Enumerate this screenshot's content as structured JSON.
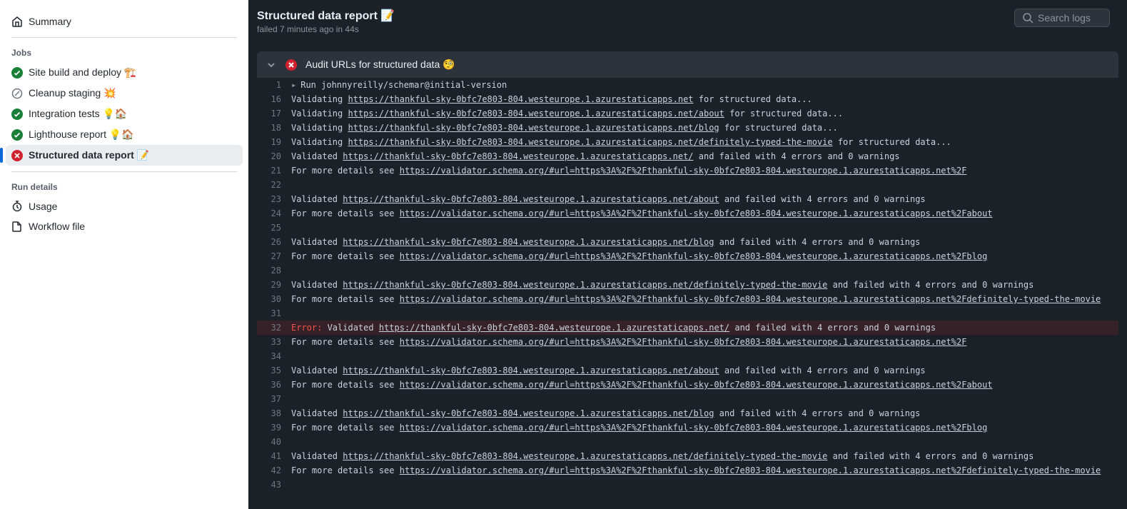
{
  "sidebar": {
    "summary_label": "Summary",
    "jobs_heading": "Jobs",
    "jobs": [
      {
        "status": "success",
        "label": "Site build and deploy 🏗️"
      },
      {
        "status": "skipped",
        "label": "Cleanup staging 💥"
      },
      {
        "status": "success",
        "label": "Integration tests 💡🏠"
      },
      {
        "status": "success",
        "label": "Lighthouse report 💡🏠"
      },
      {
        "status": "fail",
        "label": "Structured data report 📝",
        "active": true
      }
    ],
    "run_details_heading": "Run details",
    "usage_label": "Usage",
    "workflow_file_label": "Workflow file"
  },
  "header": {
    "title": "Structured data report 📝",
    "subtitle": "failed 7 minutes ago in 44s",
    "search_placeholder": "Search logs"
  },
  "step": {
    "title": "Audit URLs for structured data 🧐"
  },
  "log": {
    "lines": [
      {
        "n": 1,
        "kind": "caret",
        "text": "Run johnnyreilly/schemar@initial-version"
      },
      {
        "n": 16,
        "kind": "plain",
        "segments": [
          {
            "t": "Validating "
          },
          {
            "t": "https://thankful-sky-0bfc7e803-804.westeurope.1.azurestaticapps.net",
            "link": true
          },
          {
            "t": " for structured data..."
          }
        ]
      },
      {
        "n": 17,
        "kind": "plain",
        "segments": [
          {
            "t": "Validating "
          },
          {
            "t": "https://thankful-sky-0bfc7e803-804.westeurope.1.azurestaticapps.net/about",
            "link": true
          },
          {
            "t": " for structured data..."
          }
        ]
      },
      {
        "n": 18,
        "kind": "plain",
        "segments": [
          {
            "t": "Validating "
          },
          {
            "t": "https://thankful-sky-0bfc7e803-804.westeurope.1.azurestaticapps.net/blog",
            "link": true
          },
          {
            "t": " for structured data..."
          }
        ]
      },
      {
        "n": 19,
        "kind": "plain",
        "segments": [
          {
            "t": "Validating "
          },
          {
            "t": "https://thankful-sky-0bfc7e803-804.westeurope.1.azurestaticapps.net/definitely-typed-the-movie",
            "link": true
          },
          {
            "t": " for structured data..."
          }
        ]
      },
      {
        "n": 20,
        "kind": "plain",
        "segments": [
          {
            "t": "Validated "
          },
          {
            "t": "https://thankful-sky-0bfc7e803-804.westeurope.1.azurestaticapps.net/",
            "link": true
          },
          {
            "t": " and failed with 4 errors and 0 warnings"
          }
        ]
      },
      {
        "n": 21,
        "kind": "plain",
        "segments": [
          {
            "t": "For more details see "
          },
          {
            "t": "https://validator.schema.org/#url=https%3A%2F%2Fthankful-sky-0bfc7e803-804.westeurope.1.azurestaticapps.net%2F",
            "link": true
          }
        ]
      },
      {
        "n": 22,
        "kind": "plain",
        "segments": [
          {
            "t": ""
          }
        ]
      },
      {
        "n": 23,
        "kind": "plain",
        "segments": [
          {
            "t": "Validated "
          },
          {
            "t": "https://thankful-sky-0bfc7e803-804.westeurope.1.azurestaticapps.net/about",
            "link": true
          },
          {
            "t": " and failed with 4 errors and 0 warnings"
          }
        ]
      },
      {
        "n": 24,
        "kind": "plain",
        "segments": [
          {
            "t": "For more details see "
          },
          {
            "t": "https://validator.schema.org/#url=https%3A%2F%2Fthankful-sky-0bfc7e803-804.westeurope.1.azurestaticapps.net%2Fabout",
            "link": true
          }
        ]
      },
      {
        "n": 25,
        "kind": "plain",
        "segments": [
          {
            "t": ""
          }
        ]
      },
      {
        "n": 26,
        "kind": "plain",
        "segments": [
          {
            "t": "Validated "
          },
          {
            "t": "https://thankful-sky-0bfc7e803-804.westeurope.1.azurestaticapps.net/blog",
            "link": true
          },
          {
            "t": " and failed with 4 errors and 0 warnings"
          }
        ]
      },
      {
        "n": 27,
        "kind": "plain",
        "segments": [
          {
            "t": "For more details see "
          },
          {
            "t": "https://validator.schema.org/#url=https%3A%2F%2Fthankful-sky-0bfc7e803-804.westeurope.1.azurestaticapps.net%2Fblog",
            "link": true
          }
        ]
      },
      {
        "n": 28,
        "kind": "plain",
        "segments": [
          {
            "t": ""
          }
        ]
      },
      {
        "n": 29,
        "kind": "plain",
        "segments": [
          {
            "t": "Validated "
          },
          {
            "t": "https://thankful-sky-0bfc7e803-804.westeurope.1.azurestaticapps.net/definitely-typed-the-movie",
            "link": true
          },
          {
            "t": " and failed with 4 errors and 0 warnings"
          }
        ]
      },
      {
        "n": 30,
        "kind": "plain",
        "segments": [
          {
            "t": "For more details see "
          },
          {
            "t": "https://validator.schema.org/#url=https%3A%2F%2Fthankful-sky-0bfc7e803-804.westeurope.1.azurestaticapps.net%2Fdefinitely-typed-the-movie",
            "link": true
          }
        ]
      },
      {
        "n": 31,
        "kind": "plain",
        "segments": [
          {
            "t": ""
          }
        ]
      },
      {
        "n": 32,
        "kind": "error",
        "segments": [
          {
            "t": "Error:",
            "err": true
          },
          {
            "t": " Validated "
          },
          {
            "t": "https://thankful-sky-0bfc7e803-804.westeurope.1.azurestaticapps.net/",
            "link": true
          },
          {
            "t": " and failed with 4 errors and 0 warnings"
          }
        ]
      },
      {
        "n": 33,
        "kind": "plain",
        "segments": [
          {
            "t": "For more details see "
          },
          {
            "t": "https://validator.schema.org/#url=https%3A%2F%2Fthankful-sky-0bfc7e803-804.westeurope.1.azurestaticapps.net%2F",
            "link": true
          }
        ]
      },
      {
        "n": 34,
        "kind": "plain",
        "segments": [
          {
            "t": ""
          }
        ]
      },
      {
        "n": 35,
        "kind": "plain",
        "segments": [
          {
            "t": "Validated "
          },
          {
            "t": "https://thankful-sky-0bfc7e803-804.westeurope.1.azurestaticapps.net/about",
            "link": true
          },
          {
            "t": " and failed with 4 errors and 0 warnings"
          }
        ]
      },
      {
        "n": 36,
        "kind": "plain",
        "segments": [
          {
            "t": "For more details see "
          },
          {
            "t": "https://validator.schema.org/#url=https%3A%2F%2Fthankful-sky-0bfc7e803-804.westeurope.1.azurestaticapps.net%2Fabout",
            "link": true
          }
        ]
      },
      {
        "n": 37,
        "kind": "plain",
        "segments": [
          {
            "t": ""
          }
        ]
      },
      {
        "n": 38,
        "kind": "plain",
        "segments": [
          {
            "t": "Validated "
          },
          {
            "t": "https://thankful-sky-0bfc7e803-804.westeurope.1.azurestaticapps.net/blog",
            "link": true
          },
          {
            "t": " and failed with 4 errors and 0 warnings"
          }
        ]
      },
      {
        "n": 39,
        "kind": "plain",
        "segments": [
          {
            "t": "For more details see "
          },
          {
            "t": "https://validator.schema.org/#url=https%3A%2F%2Fthankful-sky-0bfc7e803-804.westeurope.1.azurestaticapps.net%2Fblog",
            "link": true
          }
        ]
      },
      {
        "n": 40,
        "kind": "plain",
        "segments": [
          {
            "t": ""
          }
        ]
      },
      {
        "n": 41,
        "kind": "plain",
        "segments": [
          {
            "t": "Validated "
          },
          {
            "t": "https://thankful-sky-0bfc7e803-804.westeurope.1.azurestaticapps.net/definitely-typed-the-movie",
            "link": true
          },
          {
            "t": " and failed with 4 errors and 0 warnings"
          }
        ]
      },
      {
        "n": 42,
        "kind": "plain",
        "segments": [
          {
            "t": "For more details see "
          },
          {
            "t": "https://validator.schema.org/#url=https%3A%2F%2Fthankful-sky-0bfc7e803-804.westeurope.1.azurestaticapps.net%2Fdefinitely-typed-the-movie",
            "link": true
          }
        ]
      },
      {
        "n": 43,
        "kind": "plain",
        "segments": [
          {
            "t": ""
          }
        ]
      }
    ]
  },
  "icons": {
    "home": "home-icon",
    "check": "check-circle-icon",
    "skip": "skip-icon",
    "x": "x-circle-icon",
    "stopwatch": "stopwatch-icon",
    "file": "file-icon",
    "search": "search-icon",
    "chevron": "chevron-down-icon"
  }
}
